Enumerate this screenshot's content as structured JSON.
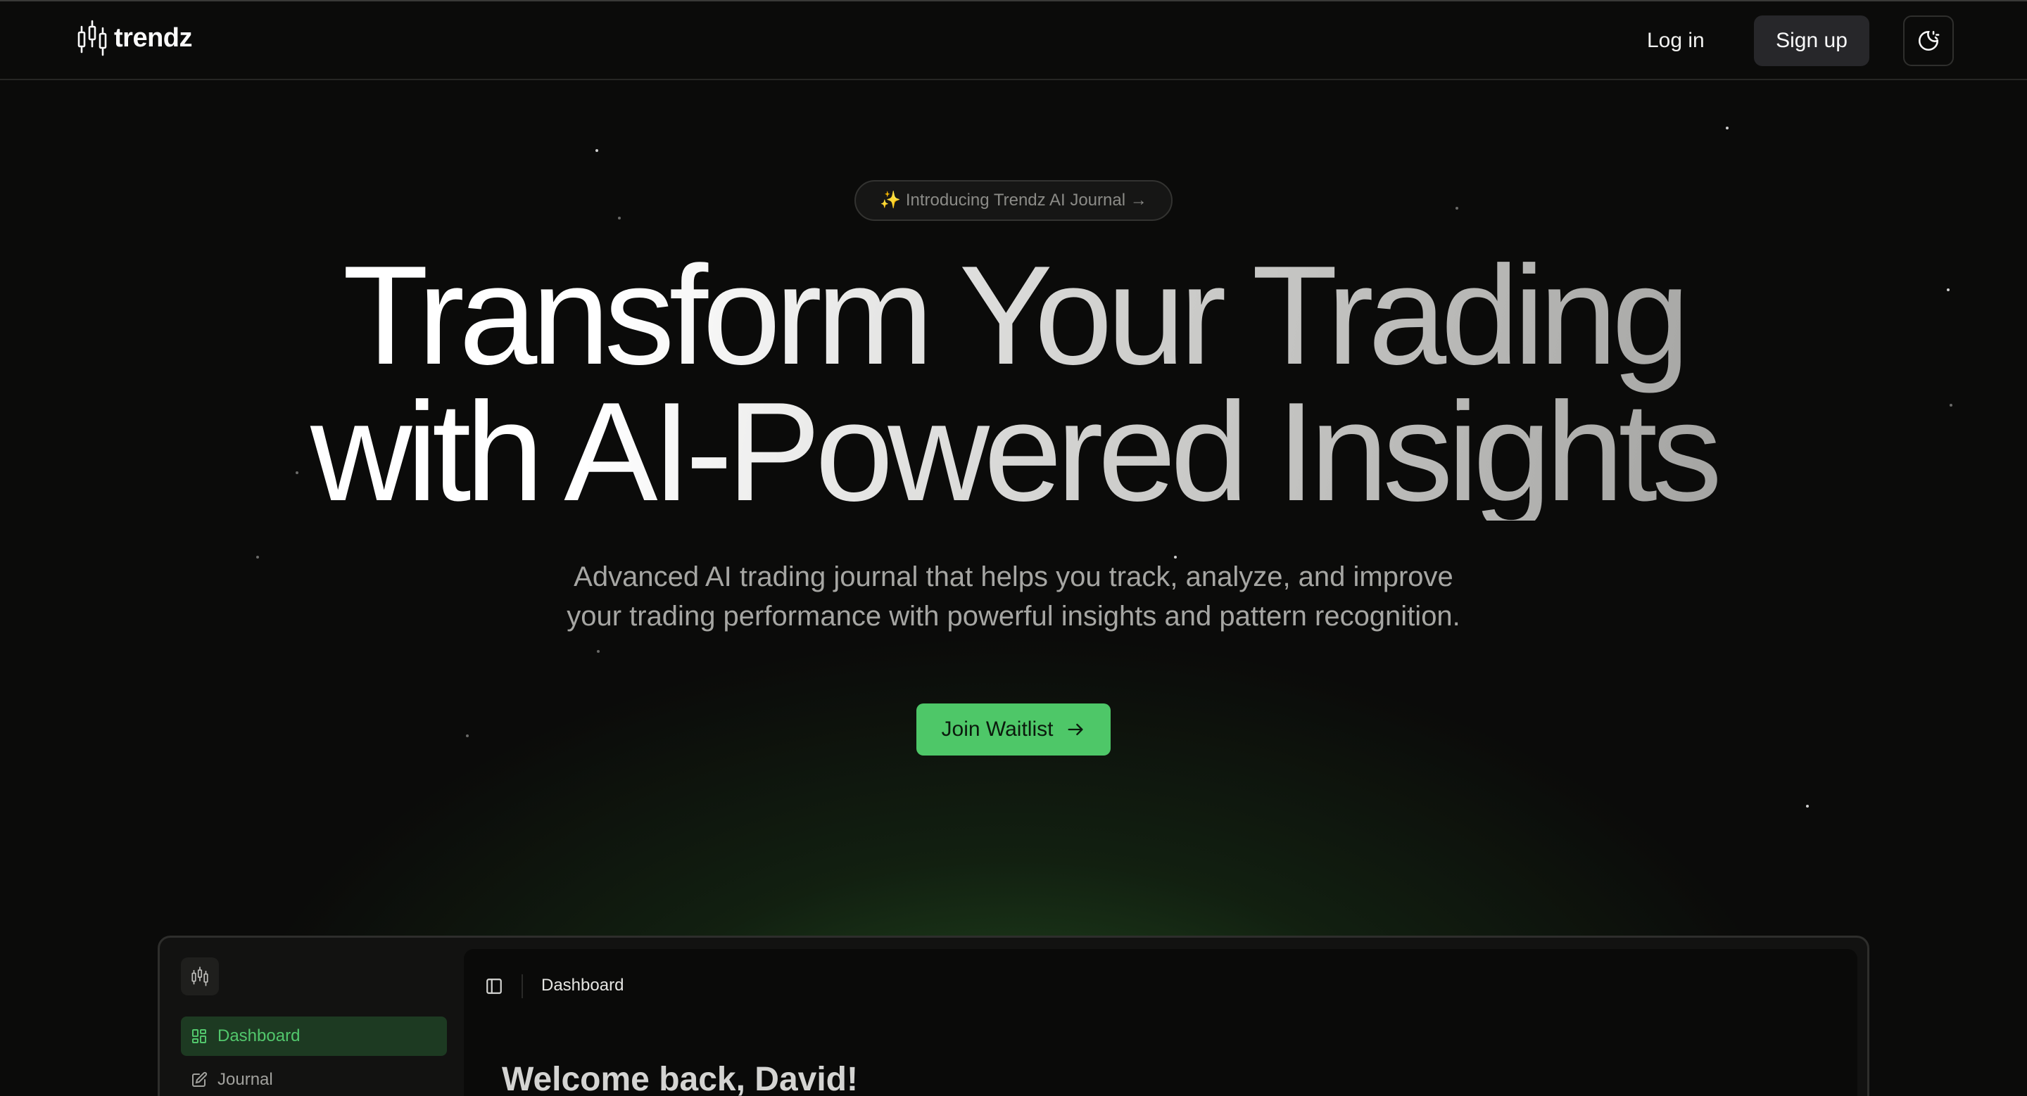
{
  "nav": {
    "brand": "trendz",
    "login_label": "Log in",
    "signup_label": "Sign up",
    "theme_icon": "moon-sun-icon"
  },
  "hero": {
    "badge": "✨ Introducing Trendz AI Journal →",
    "headline_line1": "Transform Your Trading",
    "headline_line2": "with AI-Powered Insights",
    "subtitle_line1": "Advanced AI trading journal that helps you track, analyze, and improve",
    "subtitle_line2": "your trading performance with powerful insights and pattern recognition.",
    "cta_label": "Join Waitlist"
  },
  "preview": {
    "sidebar_items": [
      {
        "label": "Dashboard",
        "icon": "grid-icon",
        "active": true
      },
      {
        "label": "Journal",
        "icon": "edit-icon",
        "active": false
      }
    ],
    "breadcrumb": "Dashboard",
    "welcome": "Welcome back, David!"
  },
  "colors": {
    "accent": "#4ec768",
    "background": "#0b0b0a",
    "active_nav_bg": "#1d3a22"
  }
}
